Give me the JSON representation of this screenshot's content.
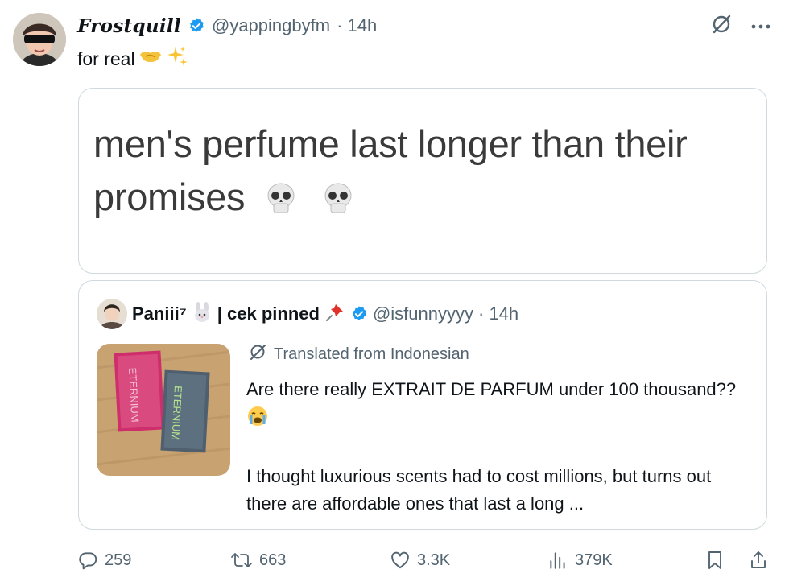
{
  "tweet": {
    "display_name": "Frostquill",
    "handle": "@yappingbyfm",
    "time": "· 14h",
    "text": "for real",
    "text_emojis": [
      "handshake",
      "sparkles"
    ]
  },
  "image_card": {
    "text": "men's perfume last longer than their promises",
    "emojis": [
      "skull",
      "skull"
    ]
  },
  "quoted": {
    "display_name": "Paniii⁷",
    "name_suffix": "| cek pinned",
    "handle": "@isfunnyyyy",
    "time": "· 14h",
    "translated_label": "Translated from Indonesian",
    "text_line1": "Are there really EXTRAIT DE PARFUM under 100 thousand??",
    "text_line2": "I thought luxurious scents had to cost millions, but turns out there are affordable ones that last a long ...",
    "image_alt_text": "ETERNIUM",
    "emojis": [
      "rabbit",
      "pushpin",
      "loudly-crying-face"
    ]
  },
  "actions": {
    "replies": "259",
    "reposts": "663",
    "likes": "3.3K",
    "views": "379K"
  },
  "colors": {
    "text": "#0f1419",
    "secondary": "#536471",
    "verified": "#1d9bf0",
    "border": "#cfd9de"
  },
  "icons": [
    "grok-icon",
    "more-icon",
    "reply-icon",
    "repost-icon",
    "like-icon",
    "views-icon",
    "bookmark-icon",
    "share-icon",
    "verified-badge-icon",
    "translate-icon"
  ]
}
